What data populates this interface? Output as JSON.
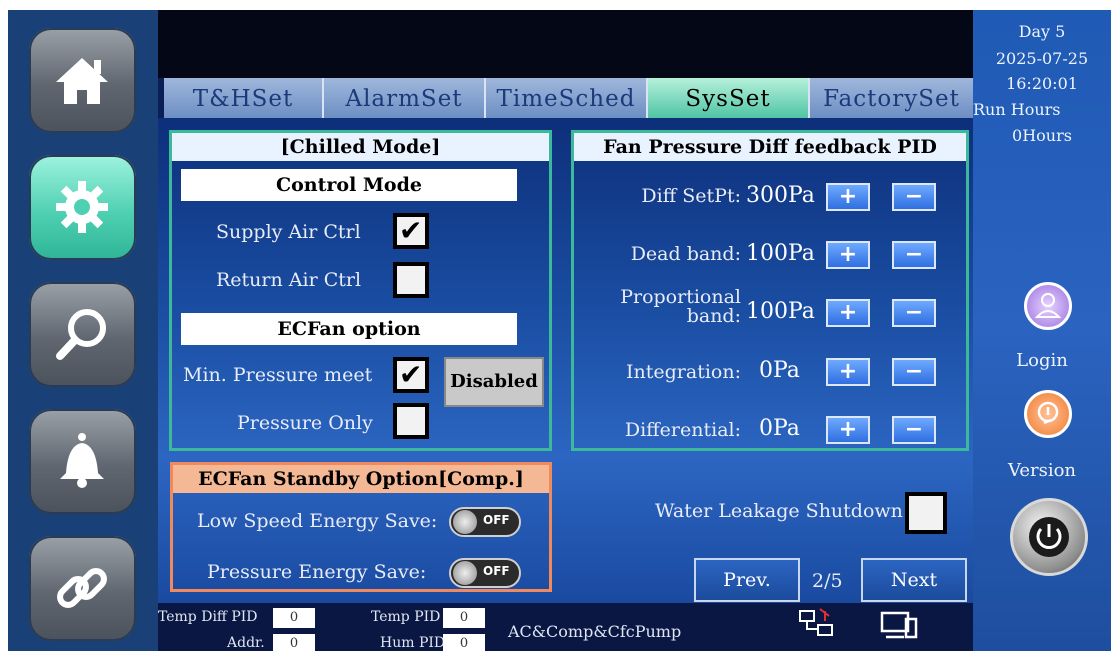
{
  "nav": [
    "home",
    "settings",
    "search",
    "alarm",
    "link"
  ],
  "tabs": [
    "T&HSet",
    "AlarmSet",
    "TimeSched",
    "SysSet",
    "FactorySet"
  ],
  "chilled": {
    "title": "[Chilled Mode]",
    "control_mode": "Control Mode",
    "supply_air": "Supply Air Ctrl",
    "return_air": "Return Air Ctrl",
    "ecfan_option": "ECFan option",
    "min_pressure": "Min. Pressure meet",
    "pressure_only": "Pressure Only",
    "disabled_button": "Disabled",
    "supply_checked": "✔",
    "min_pressure_checked": "✔"
  },
  "pid": {
    "title": "Fan Pressure Diff feedback PID",
    "rows": [
      {
        "label": "Diff SetPt:",
        "value": "300Pa"
      },
      {
        "label": "Dead band:",
        "value": "100Pa"
      },
      {
        "label1": "Proportional",
        "label2": "band:",
        "value": "100Pa"
      },
      {
        "label": "Integration:",
        "value": "0Pa"
      },
      {
        "label": "Differential:",
        "value": "0Pa"
      }
    ],
    "plus": "+",
    "minus": "−"
  },
  "standby": {
    "title": "ECFan Standby Option[Comp.]",
    "low_speed": "Low Speed Energy Save:",
    "pressure": "Pressure Energy Save:",
    "toggle_label": "OFF"
  },
  "water_leakage": "Water Leakage Shutdown",
  "pager": {
    "prev": "Prev.",
    "page": "2/5",
    "next": "Next"
  },
  "bottom": {
    "temp_diff_pid_label": "Temp Diff PID",
    "temp_diff_pid_value": "0",
    "addr_label": "Addr.",
    "addr_value": "0",
    "temp_pid_label": "Temp PID",
    "temp_pid_value": "0",
    "hum_pid_label": "Hum PID",
    "hum_pid_value": "0",
    "status": "AC&Comp&CfcPump"
  },
  "right": {
    "day": "Day  5",
    "date": "2025-07-25",
    "time": "16:20:01",
    "run_hours_label": "Run Hours",
    "run_hours_value": "0Hours",
    "login": "Login",
    "version": "Version"
  },
  "colors": {
    "accent": "#3bb99a",
    "standby_border": "#f08a5d",
    "active_tab": "#4fc4a4"
  }
}
